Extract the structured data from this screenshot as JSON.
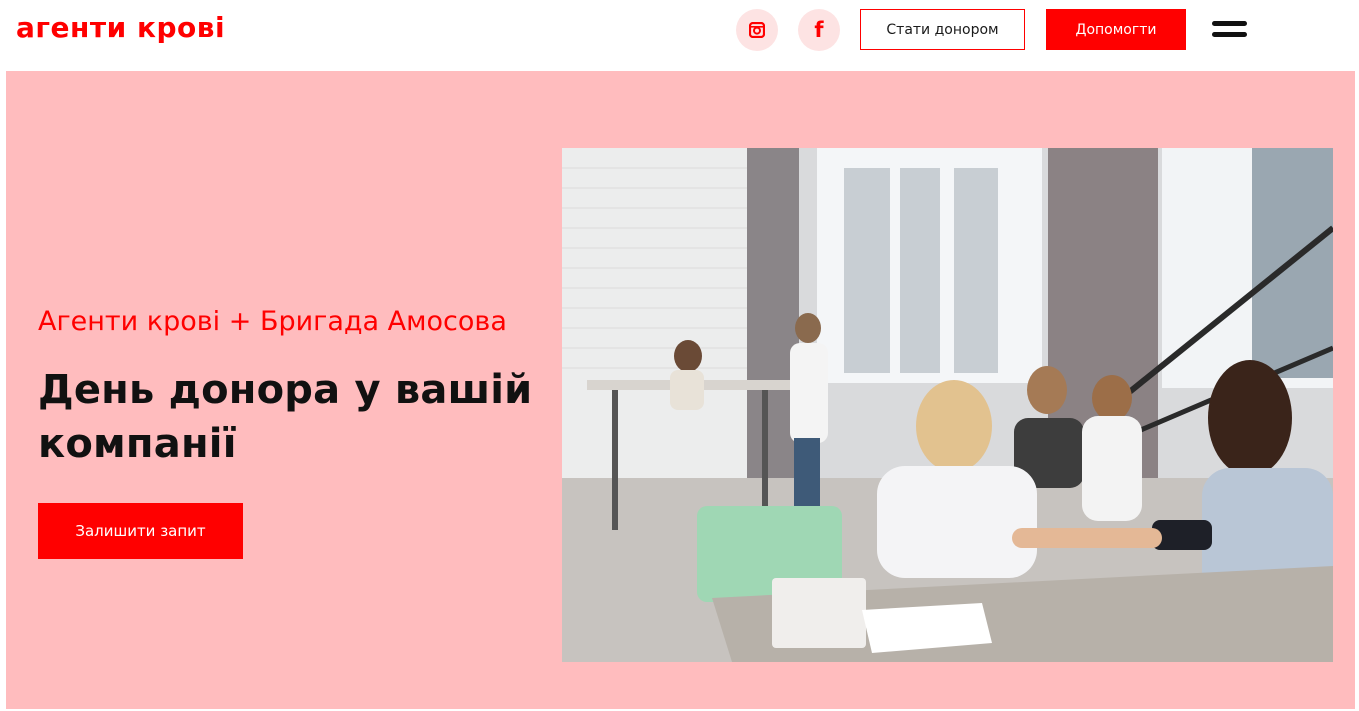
{
  "header": {
    "logo": "агенти крові",
    "social": [
      {
        "icon": "instagram-icon"
      },
      {
        "icon": "facebook-icon",
        "glyph": "f"
      }
    ],
    "become_donor_label": "Стати донором",
    "help_label": "Допомогти",
    "menu_icon": "hamburger-menu-icon"
  },
  "hero": {
    "subtitle": "Агенти крові + Бригада Амосова",
    "title": "День донора у вашій компанії",
    "cta_label": "Залишити запит",
    "image": "photo of a corporate blood donation event"
  },
  "colors": {
    "accent": "#ff0000",
    "hero_background": "#ffbcbe",
    "social_circle": "#fde3e3",
    "text_dark": "#111111"
  }
}
